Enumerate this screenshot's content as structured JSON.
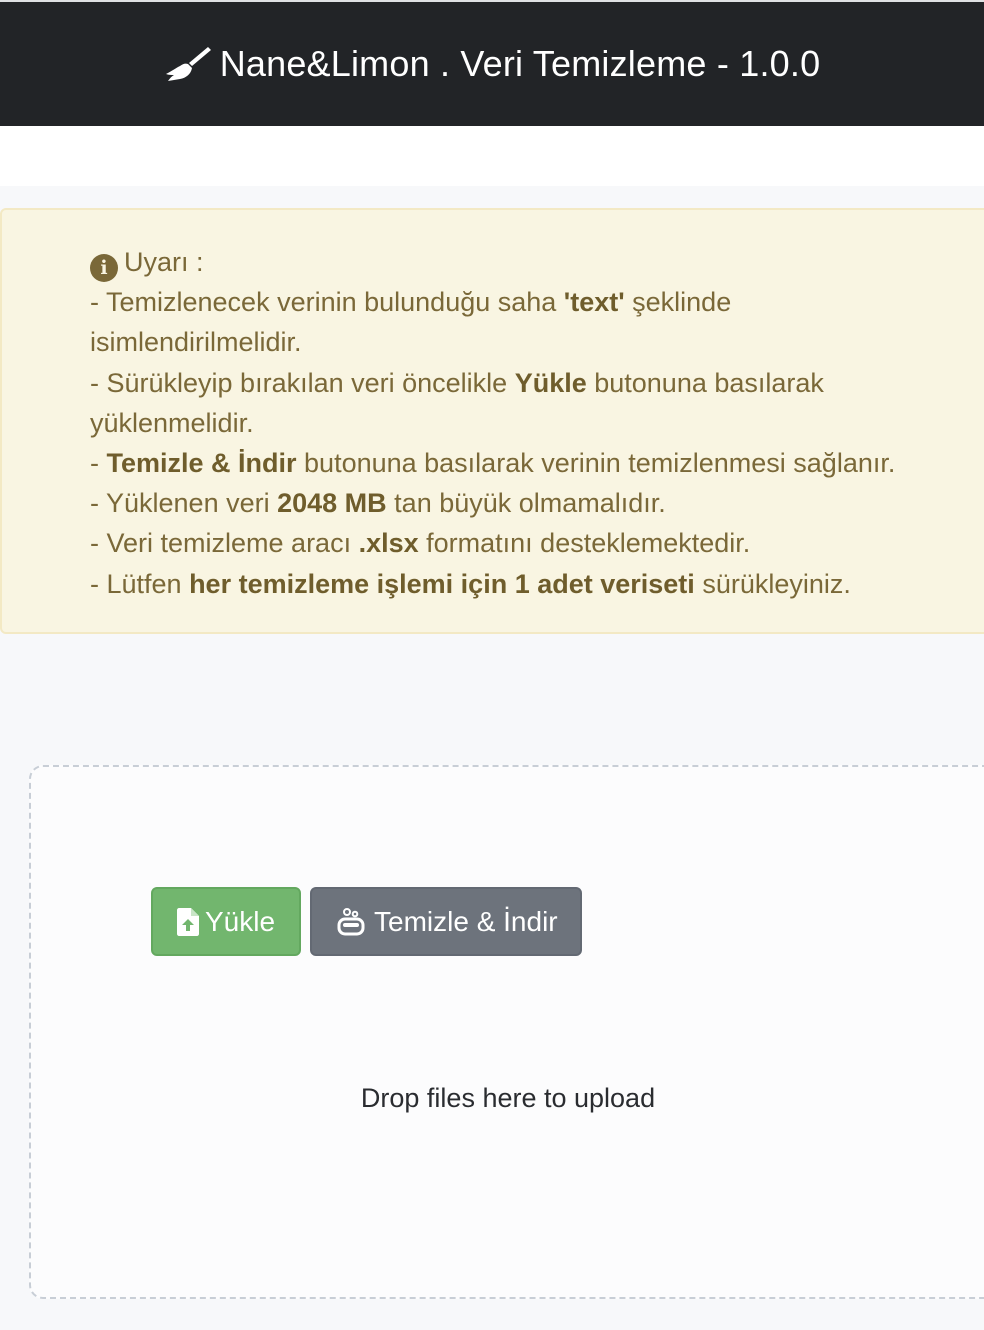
{
  "navbar": {
    "title": "Nane&Limon . Veri Temizleme - 1.0.0",
    "icon": "broom-icon"
  },
  "alert": {
    "heading": "Uyarı :",
    "icon": "info-circle-icon",
    "line1": {
      "pre": "- Temizlenecek verinin bulunduğu saha ",
      "bold": "'text'",
      "post": " şeklinde isimlendirilmelidir."
    },
    "line2": {
      "pre": "- Sürükleyip bırakılan veri öncelikle ",
      "bold": "Yükle",
      "post": " butonuna basılarak yüklenmelidir."
    },
    "line3": {
      "pre": "- ",
      "bold": "Temizle & İndir",
      "post": " butonuna basılarak verinin temizlenmesi sağlanır."
    },
    "line4": {
      "pre": "- Yüklenen veri ",
      "bold": "2048 MB",
      "post": " tan büyük olmamalıdır."
    },
    "line5": {
      "pre": "- Veri temizleme aracı ",
      "bold": ".xlsx",
      "post": " formatını desteklemektedir."
    },
    "line6": {
      "pre": "- Lütfen ",
      "bold": "her temizleme işlemi için 1 adet veriseti",
      "post": " sürükleyiniz."
    }
  },
  "dropzone": {
    "upload_button": "Yükle",
    "upload_icon": "file-upload-icon",
    "clean_button": "Temizle & İndir",
    "clean_icon": "soap-icon",
    "message": "Drop files here to upload"
  },
  "colors": {
    "navbar_bg": "#222427",
    "alert_bg": "#f9f5e2",
    "alert_text": "#7a6838",
    "upload_green": "#72b66e",
    "clean_gray": "#6d737c"
  }
}
